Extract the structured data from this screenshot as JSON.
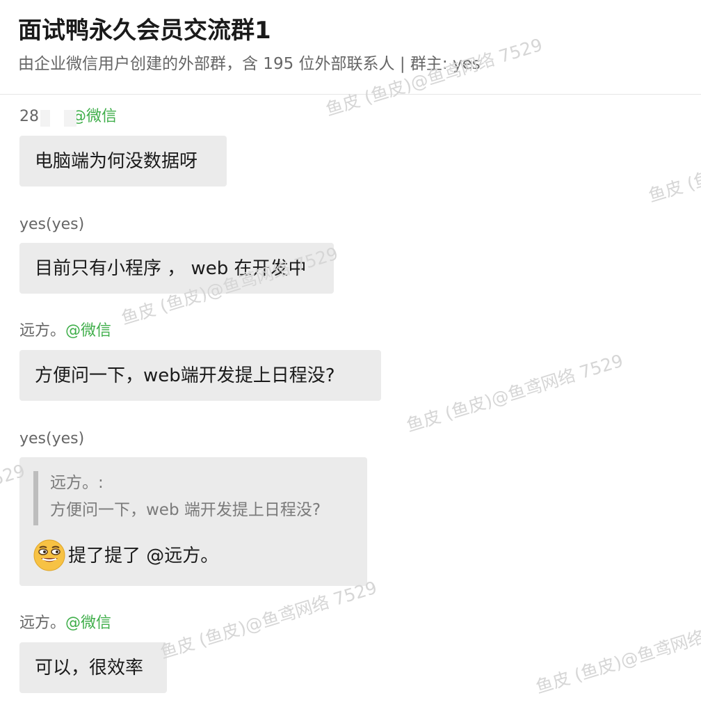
{
  "header": {
    "title": "面试鸭永久会员交流群1",
    "subtitle": "由企业微信用户创建的外部群，含 195 位外部联系人 | 群主: yes"
  },
  "watermark_text": "鱼皮 (鱼皮)@鱼鸢网络 7529",
  "messages": [
    {
      "sender_name": "28",
      "sender_source": "@微信",
      "text": "电脑端为何没数据呀"
    },
    {
      "sender_name": "yes(yes)",
      "sender_source": "",
      "text": "目前只有小程序 ， web 在开发中"
    },
    {
      "sender_name": "远方。",
      "sender_source": "@微信",
      "text": "方便问一下，web端开发提上日程没?"
    },
    {
      "sender_name": "yes(yes)",
      "sender_source": "",
      "quote_author": "远方。:",
      "quote_text": "方便问一下，web 端开发提上日程没?",
      "emoji": "grinning-face-emoji",
      "text": "提了提了 @远方。"
    },
    {
      "sender_name": "远方。",
      "sender_source": "@微信",
      "text": "可以，很效率"
    }
  ],
  "colors": {
    "bubble": "#ebebeb",
    "source_green": "#3fae4a",
    "quote_bar": "#bdbdbd",
    "watermark": "#d6d6d6"
  }
}
